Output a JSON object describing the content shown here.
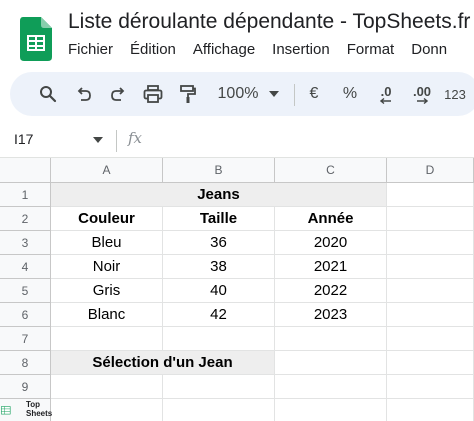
{
  "app": {
    "title": "Liste déroulante dépendante - TopSheets.fr",
    "menu": [
      "Fichier",
      "Édition",
      "Affichage",
      "Insertion",
      "Format",
      "Donn"
    ]
  },
  "toolbar": {
    "zoom": "100%",
    "currency": "€",
    "percent": "%",
    "decrease_decimal": ".0",
    "increase_decimal": ".00",
    "more_formats": "123"
  },
  "formula_bar": {
    "name_box": "I17",
    "fx_label": "fx"
  },
  "sheet": {
    "corner": "",
    "columns": [
      "A",
      "B",
      "C",
      "D"
    ],
    "rows": [
      "1",
      "2",
      "3",
      "4",
      "5",
      "6",
      "7",
      "8",
      "9"
    ],
    "cells": {
      "title": "Jeans",
      "headers": [
        "Couleur",
        "Taille",
        "Année"
      ],
      "data": [
        [
          "Bleu",
          "36",
          "2020"
        ],
        [
          "Noir",
          "38",
          "2021"
        ],
        [
          "Gris",
          "40",
          "2022"
        ],
        [
          "Blanc",
          "42",
          "2023"
        ]
      ],
      "selection_label": "Sélection d'un Jean"
    }
  },
  "watermark": {
    "line1": "Top",
    "line2": "Sheets"
  },
  "colors": {
    "sheets_green": "#0f9d58",
    "toolbar_bg": "#edf2fa",
    "header_bg": "#f8f9fa",
    "merged_bg": "#eeeeee"
  }
}
